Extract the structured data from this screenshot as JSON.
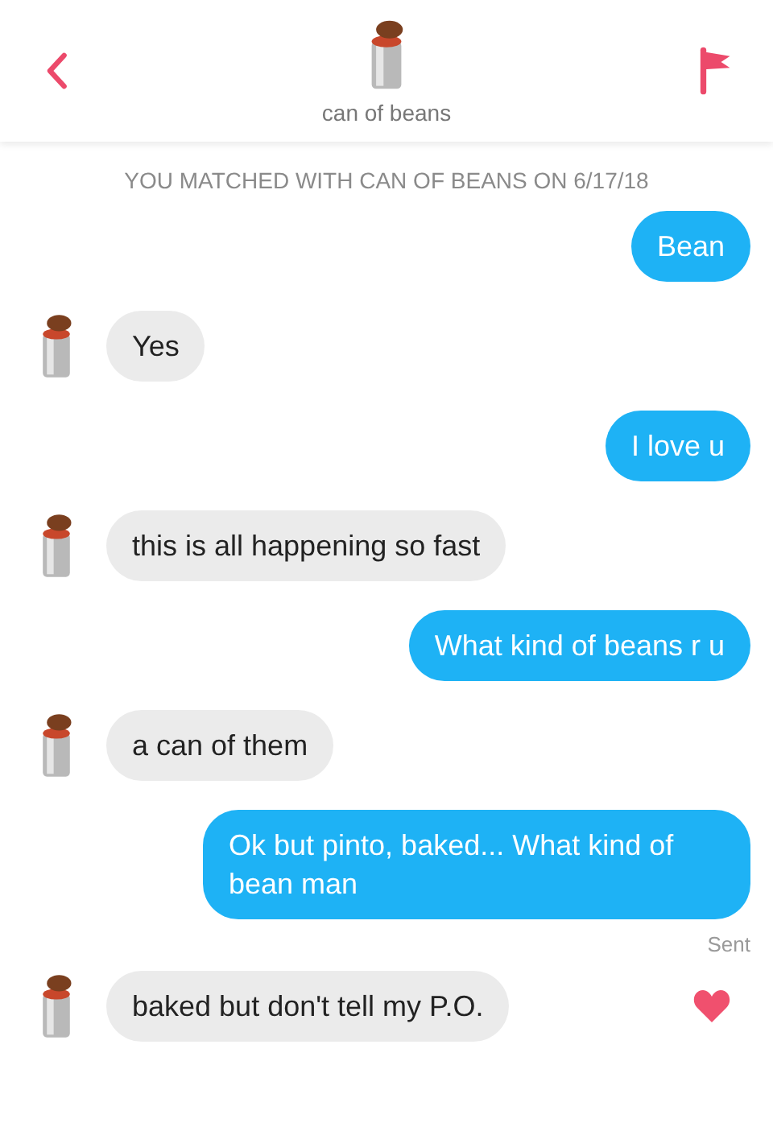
{
  "header": {
    "title": "can of beans"
  },
  "match_notice": "YOU MATCHED WITH CAN OF BEANS ON 6/17/18",
  "messages": [
    {
      "kind": "me",
      "text": "Bean"
    },
    {
      "kind": "them",
      "text": "Yes",
      "liked": false
    },
    {
      "kind": "me",
      "text": "I love u"
    },
    {
      "kind": "them",
      "text": "this is all happening so fast",
      "liked": false
    },
    {
      "kind": "me",
      "text": "What kind of beans r u"
    },
    {
      "kind": "them",
      "text": "a can of them",
      "liked": false
    },
    {
      "kind": "me",
      "text": "Ok but pinto, baked... What kind of bean man",
      "status": "Sent"
    },
    {
      "kind": "them",
      "text": "baked but don't tell my P.O.",
      "liked": true
    }
  ]
}
